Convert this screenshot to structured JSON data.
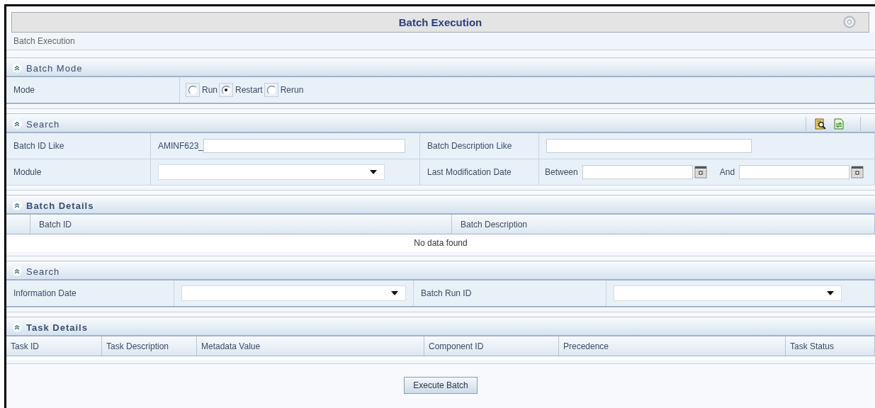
{
  "header": {
    "title": "Batch Execution",
    "breadcrumb": "Batch Execution"
  },
  "sections": [
    {
      "kind": "mode",
      "title": "Batch Mode",
      "label": "Mode",
      "options": [
        {
          "label": "Run",
          "selected": false
        },
        {
          "label": "Restart",
          "selected": true
        },
        {
          "label": "Rerun",
          "selected": false
        }
      ]
    },
    {
      "kind": "criteria",
      "title": "Search",
      "tools": true,
      "rows": [
        [
          {
            "kind": "label",
            "text": "Batch ID Like"
          },
          {
            "kind": "prefixed",
            "prefix": "AMINF623_"
          },
          {
            "kind": "label",
            "text": "Batch Description Like"
          },
          {
            "kind": "text"
          }
        ],
        [
          {
            "kind": "label",
            "text": "Module"
          },
          {
            "kind": "select"
          },
          {
            "kind": "label",
            "text": "Last Modification Date"
          },
          {
            "kind": "daterange",
            "from_label": "Between",
            "to_label": "And"
          }
        ]
      ]
    },
    {
      "kind": "table",
      "title": "Batch Details",
      "columns": [
        "Batch ID",
        "Batch Description"
      ],
      "lead_column": true,
      "empty_message": "No data found"
    },
    {
      "kind": "criteria",
      "title": "Search",
      "tools": false,
      "rows": [
        [
          {
            "kind": "label",
            "text": "Information Date"
          },
          {
            "kind": "select"
          },
          {
            "kind": "label",
            "text": "Batch Run ID"
          },
          {
            "kind": "select"
          }
        ]
      ]
    },
    {
      "kind": "table",
      "title": "Task Details",
      "columns": [
        "Task ID",
        "Task Description",
        "Metadata Value",
        "Component ID",
        "Precedence",
        "Task Status"
      ],
      "lead_column": false
    }
  ],
  "buttons": [
    "Execute Batch"
  ]
}
